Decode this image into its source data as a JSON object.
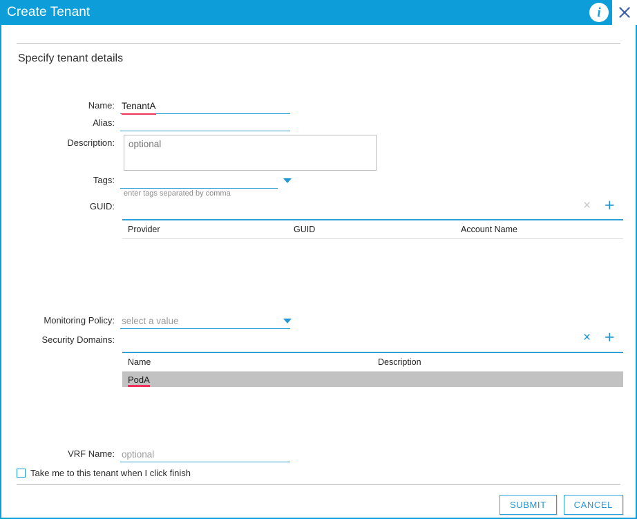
{
  "window": {
    "title": "Create Tenant",
    "info_icon": "info-icon",
    "close_icon": "close-icon"
  },
  "section": {
    "heading": "Specify tenant details"
  },
  "form": {
    "name": {
      "label": "Name:",
      "value": "TenantA"
    },
    "alias": {
      "label": "Alias:",
      "value": ""
    },
    "description": {
      "label": "Description:",
      "value": "",
      "placeholder": "optional"
    },
    "tags": {
      "label": "Tags:",
      "value": "",
      "hint": "enter tags separated by comma"
    },
    "guid": {
      "label": "GUID:"
    },
    "monitoring_policy": {
      "label": "Monitoring Policy:",
      "value": "select a value"
    },
    "security_domains": {
      "label": "Security Domains:"
    },
    "vrf_name": {
      "label": "VRF Name:",
      "value": "",
      "placeholder": "optional"
    }
  },
  "guid_table": {
    "columns": [
      "Provider",
      "GUID",
      "Account Name"
    ],
    "rows": [],
    "remove_label": "×",
    "add_label": "+"
  },
  "security_domains_table": {
    "columns": [
      "Name",
      "Description"
    ],
    "rows": [
      {
        "name": "PodA",
        "description": "",
        "selected": true,
        "misspelled": true
      }
    ],
    "remove_label": "×",
    "add_label": "+"
  },
  "checkbox": {
    "label": "Take me to this tenant when I click finish",
    "checked": false
  },
  "footer": {
    "submit_label": "SUBMIT",
    "cancel_label": "CANCEL"
  },
  "colors": {
    "accent": "#0d9dd8",
    "field_underline": "#2f9fd8",
    "spellcheck": "#f0315b",
    "row_selected": "#c2c2c2",
    "disabled_icon": "#c9c9c9"
  }
}
